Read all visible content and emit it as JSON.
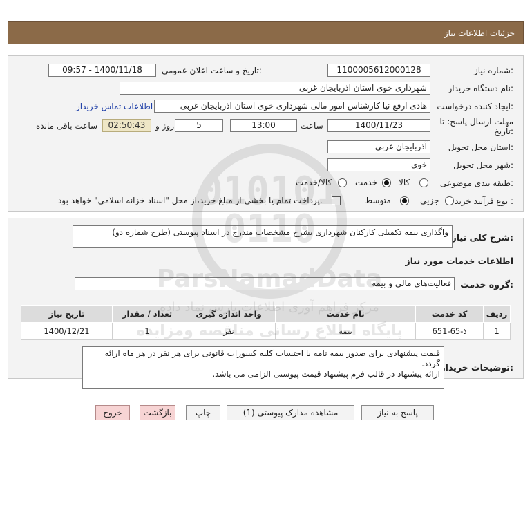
{
  "header": {
    "title": "جزئیات اطلاعات نیاز"
  },
  "form": {
    "need_number_label": "شماره نیاز:",
    "need_number": "1100005612000128",
    "announce_label": "تاریخ و ساعت اعلان عمومی:",
    "announce_value": "1400/11/18 - 09:57",
    "buyer_org_label": "نام دستگاه خریدار:",
    "buyer_org": "شهرداری خوی استان اذربایجان غربی",
    "requester_label": "ایجاد کننده درخواست:",
    "requester": "هادی ارفع نیا کارشناس امور مالی شهرداری خوی استان اذربایجان غربی",
    "contact_link": "اطلاعات تماس خریدار",
    "deadline_label_1": "مهلت ارسال پاسخ: تا",
    "deadline_label_2": "تاریخ:",
    "deadline_date": "1400/11/23",
    "time_label": "ساعت",
    "deadline_time": "13:00",
    "days_value": "5",
    "days_label": "روز و",
    "remaining_timer": "02:50:43",
    "remaining_label": "ساعت باقی مانده",
    "province_label": "استان محل تحویل:",
    "province": "آذربایجان غربی",
    "city_label": "شهر محل تحویل:",
    "city": "خوی",
    "category_label": "طبقه بندی موضوعی:",
    "category_options": [
      "کالا",
      "خدمت",
      "کالا/خدمت"
    ],
    "category_selected": "خدمت",
    "process_label": "نوع فرآیند خرید :",
    "process_options": [
      "جزیی",
      "متوسط"
    ],
    "process_selected": "متوسط",
    "payment_note": "پرداخت تمام یا بخشی از مبلغ خرید،از محل \"اسناد خزانه اسلامی\" خواهد بود."
  },
  "details": {
    "summary_label": "شرح کلی نیاز:",
    "summary": "واگذاری بیمه تکمیلی کارکنان شهرداری بشرح مشخصات مندرج در اسناد پیوستی (طرح شماره دو)",
    "services_heading": "اطلاعات خدمات مورد نیاز",
    "service_group_label": "گروه خدمت:",
    "service_group": "فعالیت‌های مالی و بیمه",
    "table": {
      "headers": [
        "ردیف",
        "کد خدمت",
        "نام خدمت",
        "واحد اندازه گیری",
        "تعداد / مقدار",
        "تاریخ نیاز"
      ],
      "rows": [
        [
          "1",
          "ذ-65-651",
          "بیمه",
          "نفر",
          "1",
          "1400/12/21"
        ]
      ]
    },
    "buyer_notes_label": "توضیحات خریدار:",
    "buyer_notes_line1": "قیمت پیشنهادی برای صدور بیمه نامه با احتساب کلیه کسورات قانونی برای هر نفر در هر ماه ارائه گردد.",
    "buyer_notes_line2": "ارائه پیشنهاد در قالب فرم پیشنهاد قیمت پیوستی الزامی می باشد."
  },
  "buttons": {
    "reply": "پاسخ به نیاز",
    "attachments": "مشاهده مدارک پیوستی (1)",
    "print": "چاپ",
    "back": "بازگشت",
    "exit": "خروج"
  },
  "watermark": {
    "brand": "ParsNamadData",
    "line1": "مرکز فراهم آوری اطلاعات پارس نماد داده",
    "line2": "پایگاه اطلاع رسانی مناقصه ومزایده"
  }
}
